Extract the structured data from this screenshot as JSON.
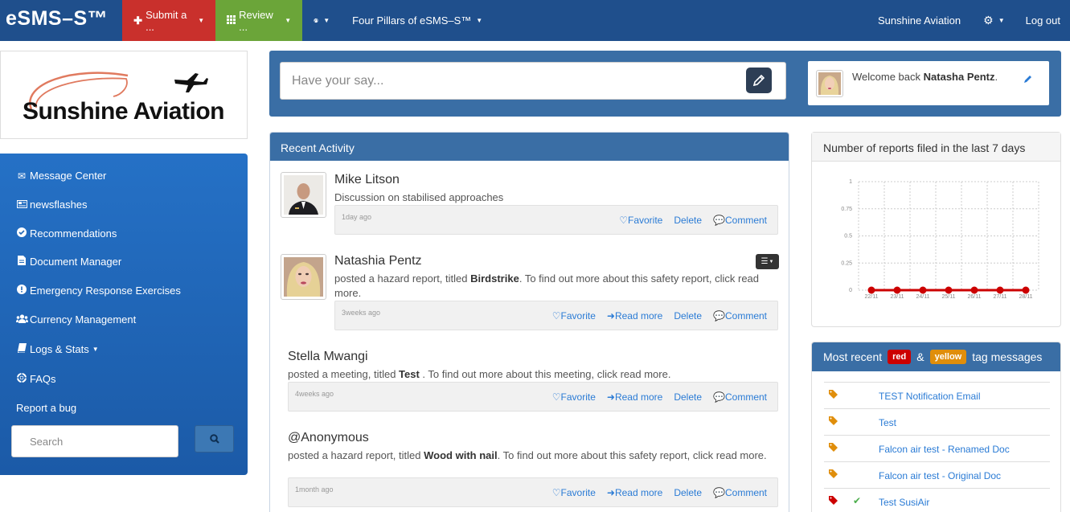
{
  "nav": {
    "brand": "eSMS–S™",
    "submit": "Submit a ...",
    "review": "Review ...",
    "four_pillars": "Four Pillars of eSMS–S™",
    "org": "Sunshine Aviation",
    "logout": "Log out"
  },
  "logo": {
    "text": "Sunshine Aviation"
  },
  "sidebar": {
    "items": [
      {
        "label": "Message Center",
        "icon": "envelope-icon"
      },
      {
        "label": "newsflashes",
        "icon": "newspaper-icon"
      },
      {
        "label": "Recommendations",
        "icon": "check-circle-icon"
      },
      {
        "label": "Document Manager",
        "icon": "file-icon"
      },
      {
        "label": "Emergency Response Exercises",
        "icon": "exclamation-circle-icon"
      },
      {
        "label": "Currency Management",
        "icon": "users-icon"
      },
      {
        "label": "Logs & Stats",
        "icon": "book-icon"
      },
      {
        "label": "FAQs",
        "icon": "lifebuoy-icon"
      },
      {
        "label": "Report a bug",
        "icon": ""
      }
    ],
    "search_placeholder": "Search"
  },
  "say": {
    "placeholder": "Have your say..."
  },
  "welcome": {
    "prefix": "Welcome back",
    "name": "Natasha Pentz",
    "suffix": "."
  },
  "activity": {
    "title": "Recent Activity",
    "posts": [
      {
        "name": "Mike Litson",
        "text": "Discussion on stabilised approaches",
        "time": "1day ago",
        "links": [
          "Favorite",
          "Delete",
          "Comment"
        ]
      },
      {
        "name": "Natashia Pentz",
        "text_prefix": "posted a hazard report, titled",
        "title": "Birdstrike",
        "text_suffix": ". To find out more about this safety report, click read more.",
        "time": "3weeks ago",
        "links": [
          "Favorite",
          "Read more",
          "Delete",
          "Comment"
        ]
      },
      {
        "name": "Stella Mwangi",
        "text_prefix": "posted a meeting, titled",
        "title": "Test",
        "text_suffix": " . To find out more about this meeting, click read more.",
        "time": "4weeks ago",
        "links": [
          "Favorite",
          "Read more",
          "Delete",
          "Comment"
        ]
      },
      {
        "name": "@Anonymous",
        "text_prefix": "posted a hazard report, titled",
        "title": "Wood with nail",
        "text_suffix": ". To find out more about this safety report, click read more.",
        "time": "1month ago",
        "links": [
          "Favorite",
          "Read more",
          "Delete",
          "Comment"
        ]
      }
    ]
  },
  "chart_data": {
    "type": "line",
    "title": "Number of reports filed in the last 7 days",
    "categories": [
      "22/11",
      "23/11",
      "24/11",
      "25/11",
      "26/11",
      "27/11",
      "28/11"
    ],
    "series": [
      {
        "values": [
          0,
          0,
          0,
          0,
          0,
          0,
          0
        ]
      }
    ],
    "yticks": [
      "0",
      "0.25",
      "0.5",
      "0.75",
      "1"
    ],
    "ylim": [
      0,
      1
    ],
    "color": "#cc0000",
    "grid": true
  },
  "tags": {
    "title_prefix": "Most recent",
    "red_label": "red",
    "amp": "&",
    "yellow_label": "yellow",
    "title_suffix": "tag messages",
    "red_color": "#cc0000",
    "yellow_color": "#e08e0b",
    "items": [
      {
        "label": "TEST Notification Email",
        "tag": "yellow",
        "check": false
      },
      {
        "label": "Test",
        "tag": "yellow",
        "check": false
      },
      {
        "label": "Falcon air test - Renamed Doc",
        "tag": "yellow",
        "check": false
      },
      {
        "label": "Falcon air test - Original Doc",
        "tag": "yellow",
        "check": false
      },
      {
        "label": "Test SusiAir",
        "tag": "red",
        "check": true
      }
    ]
  }
}
